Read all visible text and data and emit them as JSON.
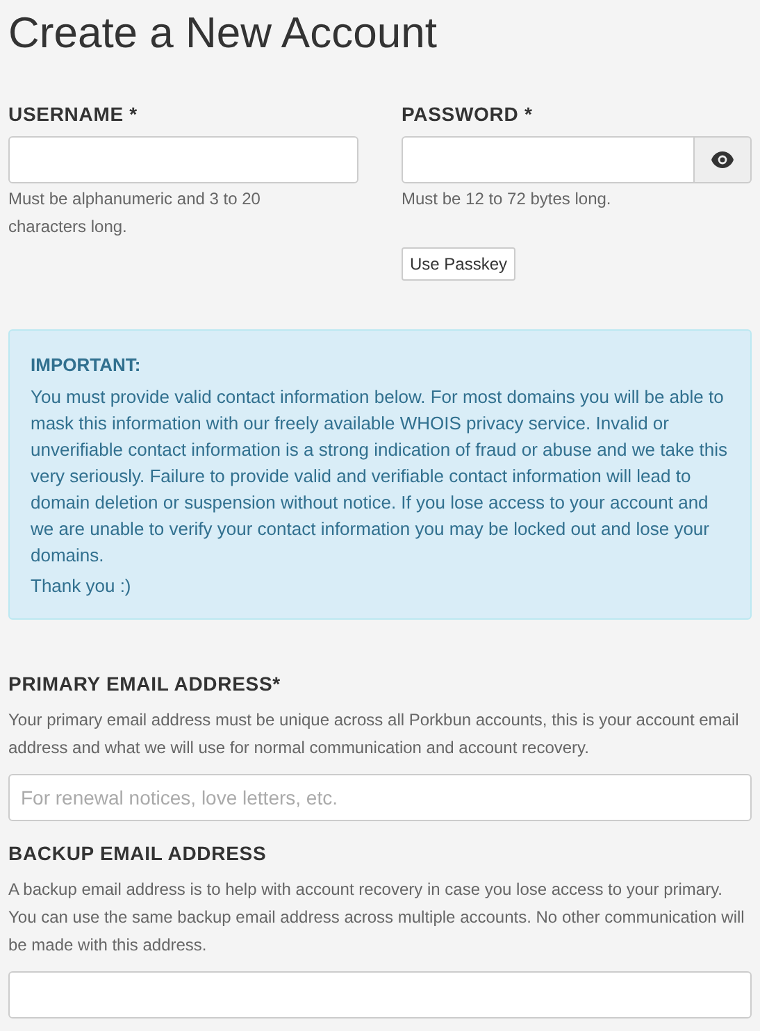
{
  "title": "Create a New Account",
  "username": {
    "label": "USERNAME *",
    "help": "Must be alphanumeric and 3 to 20 characters long."
  },
  "password": {
    "label": "PASSWORD *",
    "help": "Must be 12 to 72 bytes long.",
    "passkey_button": "Use Passkey"
  },
  "notice": {
    "heading": "IMPORTANT:",
    "body": "You must provide valid contact information below. For most domains you will be able to mask this information with our freely available WHOIS privacy service. Invalid or unverifiable contact information is a strong indication of fraud or abuse and we take this very seriously. Failure to provide valid and verifiable contact information will lead to domain deletion or suspension without notice. If you lose access to your account and we are unable to verify your contact information you may be locked out and lose your domains.",
    "thanks": "Thank you :)"
  },
  "primary_email": {
    "label": "PRIMARY EMAIL ADDRESS*",
    "help": "Your primary email address must be unique across all Porkbun accounts, this is your account email address and what we will use for normal communication and account recovery.",
    "placeholder": "For renewal notices, love letters, etc."
  },
  "backup_email": {
    "label": "BACKUP EMAIL ADDRESS",
    "help": "A backup email address is to help with account recovery in case you lose access to your primary. You can use the same backup email address across multiple accounts. No other communication will be made with this address."
  }
}
